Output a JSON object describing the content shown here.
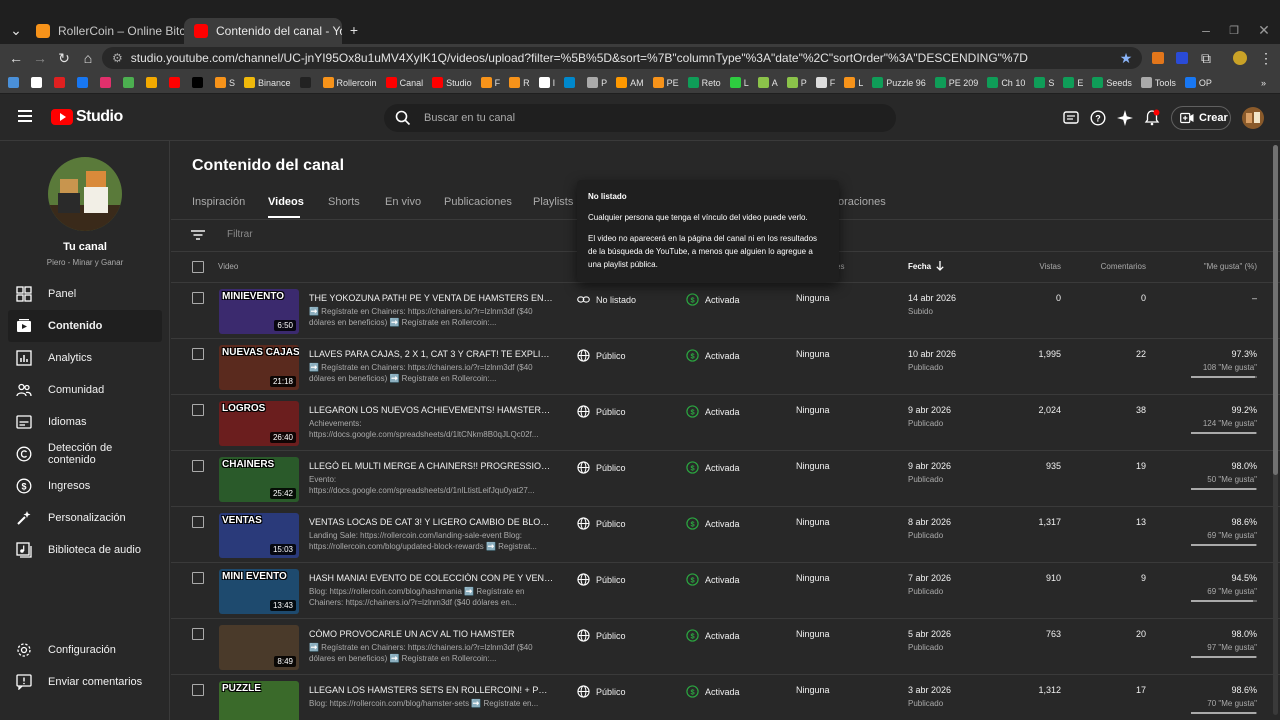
{
  "browser": {
    "tabs": [
      {
        "title": "RollerCoin – Online Bitcoin Mi",
        "active": false
      },
      {
        "title": "Contenido del canal - YouTube",
        "active": true
      }
    ],
    "url": "studio.youtube.com/channel/UC-jnYI95Ox8u1uMV4XyIK1Q/videos/upload?filter=%5B%5D&sort=%7B\"columnType\"%3A\"date\"%2C\"sortOrder\"%3A\"DESCENDING\"%7D",
    "bookmarks": [
      {
        "label": "",
        "color": "#4a90d9"
      },
      {
        "label": "",
        "color": "#ffffff"
      },
      {
        "label": "",
        "color": "#e02020"
      },
      {
        "label": "",
        "color": "#1877f2"
      },
      {
        "label": "",
        "color": "#e1306c"
      },
      {
        "label": "",
        "color": "#4caf50"
      },
      {
        "label": "",
        "color": "#f2a900"
      },
      {
        "label": "",
        "color": "#ff0000"
      },
      {
        "label": "",
        "color": "#000000"
      },
      {
        "label": "S",
        "color": "#f7931a"
      },
      {
        "label": "Binance",
        "color": "#f0b90b"
      },
      {
        "label": "",
        "color": "#222222"
      },
      {
        "label": "Rollercoin",
        "color": "#f7931a"
      },
      {
        "label": "Canal",
        "color": "#ff0000"
      },
      {
        "label": "Studio",
        "color": "#ff0000"
      },
      {
        "label": "F",
        "color": "#f7931a"
      },
      {
        "label": "R",
        "color": "#f7931a"
      },
      {
        "label": "I",
        "color": "#ffffff"
      },
      {
        "label": "",
        "color": "#0088cc"
      },
      {
        "label": "P",
        "color": "#aaaaaa"
      },
      {
        "label": "AM",
        "color": "#ff9900"
      },
      {
        "label": "PE",
        "color": "#f7931a"
      },
      {
        "label": "Reto",
        "color": "#0f9d58"
      },
      {
        "label": "L",
        "color": "#2ecc40"
      },
      {
        "label": "A",
        "color": "#8bc34a"
      },
      {
        "label": "P",
        "color": "#8bc34a"
      },
      {
        "label": "F",
        "color": "#dddddd"
      },
      {
        "label": "L",
        "color": "#f7931a"
      },
      {
        "label": "Puzzle 96",
        "color": "#0f9d58"
      },
      {
        "label": "PE 209",
        "color": "#0f9d58"
      },
      {
        "label": "Ch 10",
        "color": "#0f9d58"
      },
      {
        "label": "S",
        "color": "#0f9d58"
      },
      {
        "label": "E",
        "color": "#0f9d58"
      },
      {
        "label": "Seeds",
        "color": "#0f9d58"
      },
      {
        "label": "Tools",
        "color": "#aaaaaa"
      },
      {
        "label": "OP",
        "color": "#1877f2"
      }
    ]
  },
  "header": {
    "logo_text": "Studio",
    "search_placeholder": "Buscar en tu canal",
    "create_label": "Crear"
  },
  "sidebar": {
    "channel_title": "Tu canal",
    "channel_name": "Piero - Minar y Ganar",
    "items": [
      {
        "label": "Panel",
        "icon": "dashboard-icon",
        "active": false
      },
      {
        "label": "Contenido",
        "icon": "content-icon",
        "active": true
      },
      {
        "label": "Analytics",
        "icon": "analytics-icon",
        "active": false
      },
      {
        "label": "Comunidad",
        "icon": "community-icon",
        "active": false
      },
      {
        "label": "Idiomas",
        "icon": "subtitles-icon",
        "active": false
      },
      {
        "label": "Detección de contenido",
        "icon": "copyright-icon",
        "active": false
      },
      {
        "label": "Ingresos",
        "icon": "earn-icon",
        "active": false
      },
      {
        "label": "Personalización",
        "icon": "customization-icon",
        "active": false
      },
      {
        "label": "Biblioteca de audio",
        "icon": "audio-library-icon",
        "active": false
      }
    ],
    "bottom_items": [
      {
        "label": "Configuración",
        "icon": "gear-icon"
      },
      {
        "label": "Enviar comentarios",
        "icon": "feedback-icon"
      }
    ]
  },
  "main": {
    "page_title": "Contenido del canal",
    "tabs": [
      "Inspiración",
      "Videos",
      "Shorts",
      "En vivo",
      "Publicaciones",
      "Playlists",
      "oraciones"
    ],
    "active_tab": "Videos",
    "filter_placeholder": "Filtrar",
    "columns": {
      "video": "Video",
      "restrictions": "es",
      "date": "Fecha",
      "views": "Vistas",
      "comments": "Comentarios",
      "likes": "\"Me gusta\" (%)"
    },
    "rows": [
      {
        "thumb_text": "MINIEVENTO",
        "thumb_color": "#3b2a6e",
        "duration": "6:50",
        "title": "THE YOKOZUNA PATH! PE Y VENTA DE HAMSTERS EN PERS...",
        "desc": "➡️ Regístrate en Chainers: https://chainers.io/?r=lzlnm3df ($40 dólares en beneficios) ➡️ Regístrate en Rollercoin:...",
        "visibility": "No listado",
        "vis_icon": "link-icon",
        "monetization": "Activada",
        "restrictions": "Ninguna",
        "date": "14 abr 2026",
        "date_status": "Subido",
        "views": "0",
        "comments": "0",
        "likes": "–",
        "likes_sub": "",
        "like_pct": 0
      },
      {
        "thumb_text": "NUEVAS CAJAS",
        "thumb_color": "#5a2a1e",
        "duration": "21:18",
        "title": "LLAVES PARA CAJAS, 2 X 1, CAT 3 Y CRAFT! TE EXPLICO TO...",
        "desc": "➡️ Regístrate en Chainers: https://chainers.io/?r=lzlnm3df ($40 dólares en beneficios) ➡️ Regístrate en Rollercoin:...",
        "visibility": "Público",
        "vis_icon": "globe-icon",
        "monetization": "Activada",
        "restrictions": "Ninguna",
        "date": "10 abr 2026",
        "date_status": "Publicado",
        "views": "1,995",
        "comments": "22",
        "likes": "97.3%",
        "likes_sub": "108 \"Me gusta\"",
        "like_pct": 97.3
      },
      {
        "thumb_text": "LOGROS",
        "thumb_color": "#6b1e1e",
        "duration": "26:40",
        "title": "LLEGARON LOS NUEVOS ACHIEVEMENTS! HAMSTERS SETS...",
        "desc": "Achievements: https://docs.google.com/spreadsheets/d/1ltCNkm8B0qJLQc02f...",
        "visibility": "Público",
        "vis_icon": "globe-icon",
        "monetization": "Activada",
        "restrictions": "Ninguna",
        "date": "9 abr 2026",
        "date_status": "Publicado",
        "views": "2,024",
        "comments": "38",
        "likes": "99.2%",
        "likes_sub": "124 \"Me gusta\"",
        "like_pct": 99.2
      },
      {
        "thumb_text": "CHAINERS",
        "thumb_color": "#2a5a2a",
        "duration": "25:42",
        "title": "LLEGÓ EL MULTI MERGE A CHAINERS!! PROGRESSION EVEN...",
        "desc": "Evento: https://docs.google.com/spreadsheets/d/1nlLtistLeifJqu0yat27...",
        "visibility": "Público",
        "vis_icon": "globe-icon",
        "monetization": "Activada",
        "restrictions": "Ninguna",
        "date": "9 abr 2026",
        "date_status": "Publicado",
        "views": "935",
        "comments": "19",
        "likes": "98.0%",
        "likes_sub": "50 \"Me gusta\"",
        "like_pct": 98.0
      },
      {
        "thumb_text": "VENTAS",
        "thumb_color": "#2a3a7a",
        "duration": "15:03",
        "title": "VENTAS LOCAS DE CAT 3! Y LIGERO CAMBIO DE BLOQUES E...",
        "desc": "Landing Sale: https://rollercoin.com/landing-sale-event Blog: https://rollercoin.com/blog/updated-block-rewards ➡️ Registrat...",
        "visibility": "Público",
        "vis_icon": "globe-icon",
        "monetization": "Activada",
        "restrictions": "Ninguna",
        "date": "8 abr 2026",
        "date_status": "Publicado",
        "views": "1,317",
        "comments": "13",
        "likes": "98.6%",
        "likes_sub": "69 \"Me gusta\"",
        "like_pct": 98.6
      },
      {
        "thumb_text": "MINI EVENTO",
        "thumb_color": "#1e4a6e",
        "duration": "13:43",
        "title": "HASH MANIA! EVENTO DE COLECCIÓN CON PE Y VENTA MI...",
        "desc": "Blog: https://rollercoin.com/blog/hashmania ➡️ Regístrate en Chainers: https://chainers.io/?r=lzlnm3df ($40 dólares en...",
        "visibility": "Público",
        "vis_icon": "globe-icon",
        "monetization": "Activada",
        "restrictions": "Ninguna",
        "date": "7 abr 2026",
        "date_status": "Publicado",
        "views": "910",
        "comments": "9",
        "likes": "94.5%",
        "likes_sub": "69 \"Me gusta\"",
        "like_pct": 94.5
      },
      {
        "thumb_text": "",
        "thumb_color": "#4a3a2a",
        "duration": "8:49",
        "title": "CÓMO PROVOCARLE UN ACV AL TIO HAMSTER",
        "desc": "➡️ Regístrate en Chainers: https://chainers.io/?r=lzlnm3df ($40 dólares en beneficios) ➡️ Regístrate en Rollercoin:...",
        "visibility": "Público",
        "vis_icon": "globe-icon",
        "monetization": "Activada",
        "restrictions": "Ninguna",
        "date": "5 abr 2026",
        "date_status": "Publicado",
        "views": "763",
        "comments": "20",
        "likes": "98.0%",
        "likes_sub": "97 \"Me gusta\"",
        "like_pct": 98.0
      },
      {
        "thumb_text": "PUZZLE",
        "thumb_color": "#3a6a2a",
        "duration": "",
        "title": "LLEGAN LOS HAMSTERS SETS EN ROLLERCOIN! + POZOLE ...",
        "desc": "Blog: https://rollercoin.com/blog/hamster-sets ➡️ Regístrate en...",
        "visibility": "Público",
        "vis_icon": "globe-icon",
        "monetization": "Activada",
        "restrictions": "Ninguna",
        "date": "3 abr 2026",
        "date_status": "Publicado",
        "views": "1,312",
        "comments": "17",
        "likes": "98.6%",
        "likes_sub": "70 \"Me gusta\"",
        "like_pct": 98.6
      }
    ]
  },
  "tooltip": {
    "title": "No listado",
    "line1": "Cualquier persona que tenga el vínculo del video puede verlo.",
    "line2": "El video no aparecerá en la página del canal ni en los resultados de la búsqueda de YouTube, a menos que alguien lo agregue a una playlist pública."
  }
}
